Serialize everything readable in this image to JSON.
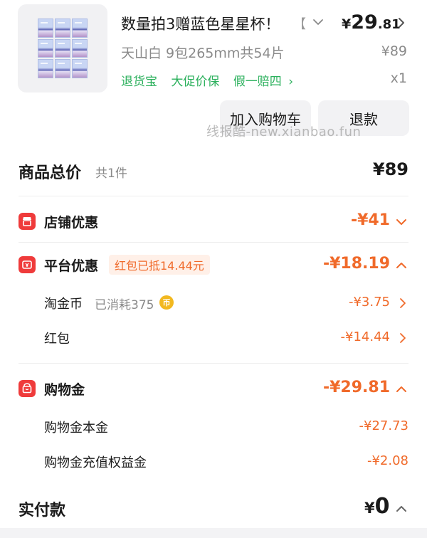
{
  "product": {
    "title": "数量拍3赠蓝色星星杯！",
    "title_bracket": "【",
    "price_currency": "¥",
    "price_integer": "29",
    "price_decimal": ".81",
    "sku": "天山白 9包265mm共54片",
    "original_price": "¥89",
    "services": [
      "退货宝",
      "大促价保",
      "假一赔四"
    ],
    "services_arrow": "›",
    "quantity": "x1",
    "buttons": {
      "add_to_cart": "加入购物车",
      "refund": "退款"
    },
    "watermark": "线报酷-new.xianbao.fun"
  },
  "summary": {
    "total_label": "商品总价",
    "total_count": "共1件",
    "total_amount": "¥89",
    "store_discount": {
      "label": "店铺优惠",
      "amount": "-¥41"
    },
    "platform_discount": {
      "label": "平台优惠",
      "tag": "红包已抵14.44元",
      "amount": "-¥18.19",
      "items": [
        {
          "label": "淘金币",
          "note": "已消耗375",
          "amount": "-¥3.75"
        },
        {
          "label": "红包",
          "amount": "-¥14.44"
        }
      ]
    },
    "shopping_credit": {
      "label": "购物金",
      "amount": "-¥29.81",
      "items": [
        {
          "label": "购物金本金",
          "amount": "-¥27.73"
        },
        {
          "label": "购物金充值权益金",
          "amount": "-¥2.08"
        }
      ]
    },
    "paid_label": "实付款",
    "paid_currency": "¥",
    "paid_amount": "0"
  },
  "icons": {
    "coin_glyph": "币",
    "store": "store-icon",
    "platform": "coupon-icon",
    "credit": "wallet-icon"
  },
  "colors": {
    "accent_orange": "#f06a2a",
    "service_green": "#2bb05c",
    "icon_red": "#ef3b3b",
    "coin_gold": "#f2b81f",
    "muted_gray": "#8a8a8a"
  }
}
